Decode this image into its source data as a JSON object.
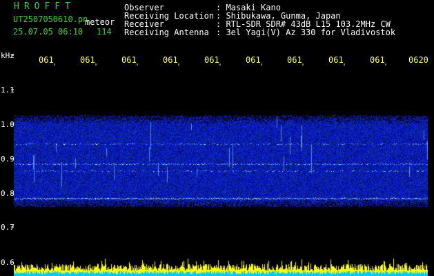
{
  "header": {
    "brand": "HROFFT",
    "filename": "UT2507050610.pn",
    "mode": "meteor",
    "date_time": "25.07.05 06:10",
    "count": "114",
    "info": [
      {
        "label": "Observer",
        "value": ": Masaki Kano"
      },
      {
        "label": "Receiving Location",
        "value": ": Shibukawa, Gunma, Japan"
      },
      {
        "label": "Receiver",
        "value": ": RTL-SDR SDR# 43dB L15 103.2MHz CW"
      },
      {
        "label": "Receiving Antenna",
        "value": ": 3el Yagi(V) Az 330 for Vladivostok"
      }
    ]
  },
  "axis": {
    "unit": "kHz",
    "y_ticks": [
      "1.1",
      "1.0",
      "0.9",
      "0.8",
      "0.7",
      "0.6"
    ],
    "x_ticks": [
      "061",
      "061",
      "061",
      "061",
      "061",
      "061",
      "061",
      "061",
      "061",
      "0620"
    ]
  },
  "colors": {
    "brand_green": "#3cd23c",
    "text_white": "#ffffff",
    "tick_yellow": "#ffff66",
    "spectrum_blue": "#1e3cff",
    "echo_cyan": "#55ffff",
    "level_yellow": "#ffff00",
    "level_cyan": "#00c8ff"
  }
}
